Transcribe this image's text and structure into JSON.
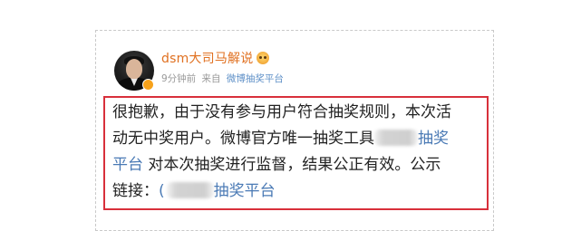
{
  "post": {
    "username": "dsm大司马解说",
    "emoji_icon": "smile-emoji-icon",
    "avatar_icon": "man-portrait-avatar-icon",
    "verify_badge_icon": "verified-badge-icon",
    "time": "9分钟前",
    "from_label": "来自",
    "source": "微博抽奖平台",
    "content": {
      "line1": "很抱歉，由于没有参与用户符合抽奖规则，本次活",
      "line2_pre": "动无中奖用户。微博官方唯一抽奖工具",
      "line2_link": "抽奖",
      "line3_link": "平台",
      "line3_post": " 对本次抽奖进行监督，结果公正有效。公示",
      "line4_pre": "链接：",
      "line4_link_prefix": "(",
      "line4_link": "抽奖平台"
    }
  },
  "colors": {
    "username": "#e07020",
    "link": "#4a7ab5",
    "highlight_border": "#d8303b",
    "meta_text": "#9a9a9a"
  }
}
